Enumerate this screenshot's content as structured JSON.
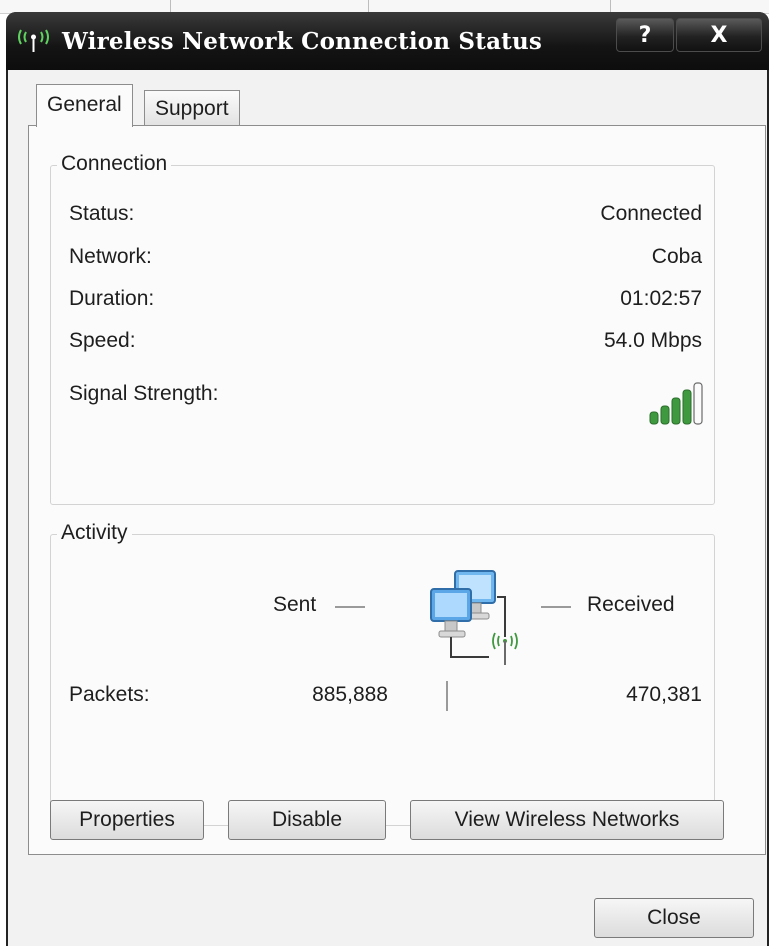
{
  "window": {
    "title": "Wireless Network Connection Status",
    "icon": "wireless-network-icon",
    "help_label": "?",
    "close_label": "X"
  },
  "tabs": [
    {
      "label": "General",
      "active": true
    },
    {
      "label": "Support",
      "active": false
    }
  ],
  "connection": {
    "group_label": "Connection",
    "rows": [
      {
        "label": "Status:",
        "value": "Connected"
      },
      {
        "label": "Network:",
        "value": "Coba"
      },
      {
        "label": "Duration:",
        "value": "01:02:57"
      },
      {
        "label": "Speed:",
        "value": "54.0 Mbps"
      }
    ],
    "signal_label": "Signal Strength:",
    "signal_bars_filled": 4,
    "signal_bars_total": 5
  },
  "activity": {
    "group_label": "Activity",
    "sent_label": "Sent",
    "received_label": "Received",
    "packets_label": "Packets:",
    "packets_sent": "885,888",
    "packets_received": "470,381"
  },
  "buttons": {
    "properties": "Properties",
    "disable": "Disable",
    "view_wireless": "View Wireless Networks",
    "close": "Close"
  },
  "colors": {
    "titlebar": "#141414",
    "signal_green": "#3f9a3f",
    "dialog_bg": "#f2f2f2"
  }
}
